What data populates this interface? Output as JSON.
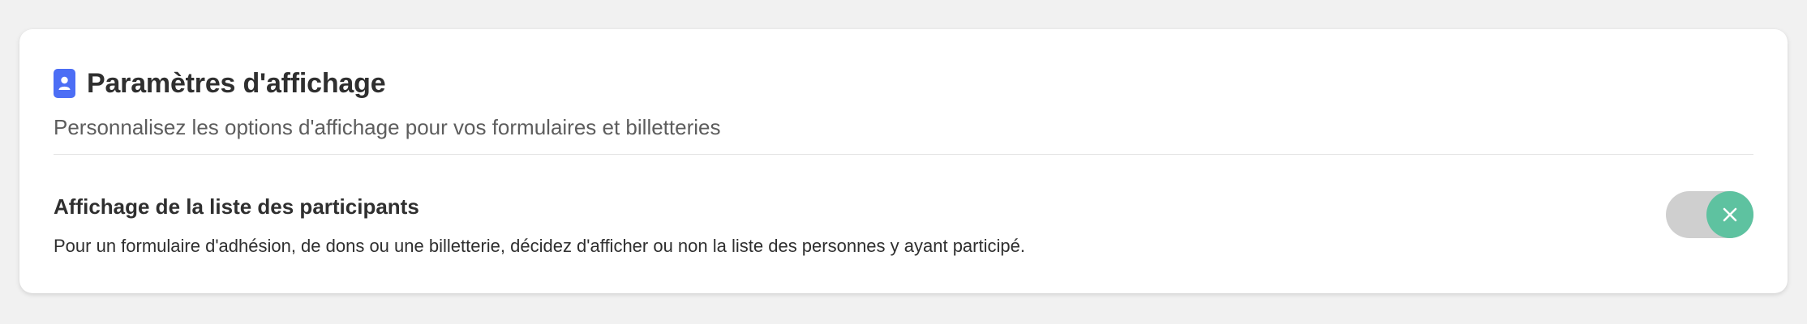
{
  "section": {
    "icon": "user-badge-icon",
    "title": "Paramètres d'affichage",
    "subtitle": "Personnalisez les options d'affichage pour vos formulaires et billetteries"
  },
  "setting": {
    "title": "Affichage de la liste des participants",
    "description": "Pour un formulaire d'adhésion, de dons ou une billetterie, décidez d'afficher ou non la liste des personnes y ayant participé.",
    "toggle": {
      "state": "off",
      "icon": "close-icon"
    }
  },
  "colors": {
    "accent": "#4c6ef5",
    "toggle_knob": "#5ec2a0",
    "toggle_track": "#cfcfcf",
    "background": "#f1f1f1",
    "card": "#ffffff"
  }
}
